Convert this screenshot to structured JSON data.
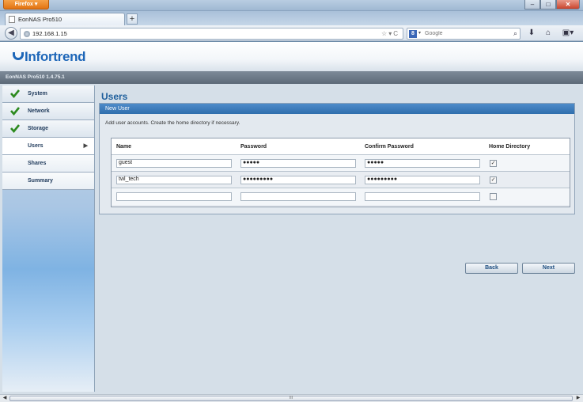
{
  "browser": {
    "menu_button": "Firefox",
    "window_controls": [
      "–",
      "□",
      "✕"
    ],
    "tab_title": "EonNAS Pro510",
    "new_tab": "+",
    "url": "192.168.1.15",
    "search_placeholder": "Google"
  },
  "brand": {
    "logo_text": "Infortrend",
    "version": "EonNAS Pro510 1.4.75.1"
  },
  "sidebar": {
    "items": [
      {
        "label": "System",
        "done": true
      },
      {
        "label": "Network",
        "done": true
      },
      {
        "label": "Storage",
        "done": true
      },
      {
        "label": "Users",
        "active": true
      },
      {
        "label": "Shares"
      },
      {
        "label": "Summary"
      }
    ],
    "arrow": "▶"
  },
  "main": {
    "title": "Users",
    "panel_title": "New User",
    "description": "Add user accounts. Create the home directory if necessary.",
    "columns": [
      "Name",
      "Password",
      "Confirm Password",
      "Home Directory"
    ],
    "rows": [
      {
        "name": "guest",
        "password": "●●●●●",
        "confirm": "●●●●●",
        "home": "✓"
      },
      {
        "name": "twl_tech",
        "password": "●●●●●●●●●",
        "confirm": "●●●●●●●●●",
        "home": "✓"
      },
      {
        "name": "",
        "password": "",
        "confirm": "",
        "home": ""
      }
    ],
    "back_label": "Back",
    "next_label": "Next"
  },
  "scrollbar": {
    "grip": "III"
  }
}
